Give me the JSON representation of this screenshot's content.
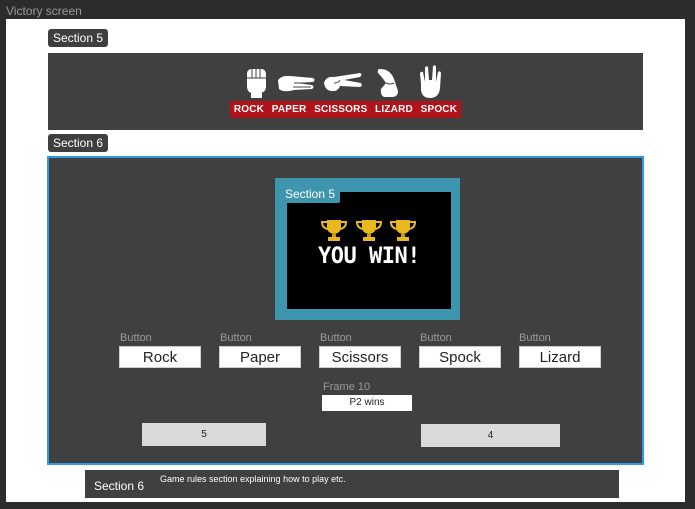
{
  "frame_title": "Victory screen",
  "section5": {
    "tag": "Section 5",
    "gestures": [
      {
        "label": "ROCK",
        "icon": "rock-hand-icon"
      },
      {
        "label": "PAPER",
        "icon": "paper-hand-icon"
      },
      {
        "label": "SCISSORS",
        "icon": "scissors-hand-icon"
      },
      {
        "label": "LIZARD",
        "icon": "lizard-hand-icon"
      },
      {
        "label": "SPOCK",
        "icon": "spock-hand-icon"
      }
    ]
  },
  "section6": {
    "tag": "Section 6",
    "screen": {
      "tag": "Section 5",
      "trophies": [
        "trophy-icon",
        "trophy-icon",
        "trophy-icon"
      ],
      "headline": "YOU WIN!"
    },
    "buttons": [
      {
        "caption": "Button",
        "label": "Rock"
      },
      {
        "caption": "Button",
        "label": "Paper"
      },
      {
        "caption": "Button",
        "label": "Scissors"
      },
      {
        "caption": "Button",
        "label": "Spock"
      },
      {
        "caption": "Button",
        "label": "Lizard"
      }
    ],
    "result": {
      "caption": "Frame 10",
      "value": "P2 wins"
    },
    "scores": {
      "left": "5",
      "right": "4"
    }
  },
  "rules": {
    "tag": "Section 6",
    "text": "Game rules section explaining how to play etc."
  },
  "colors": {
    "accent_blue": "#2e9be8",
    "screen_teal": "#3d96ad",
    "label_red": "#b0131a",
    "trophy_gold": "#e8b81c"
  }
}
